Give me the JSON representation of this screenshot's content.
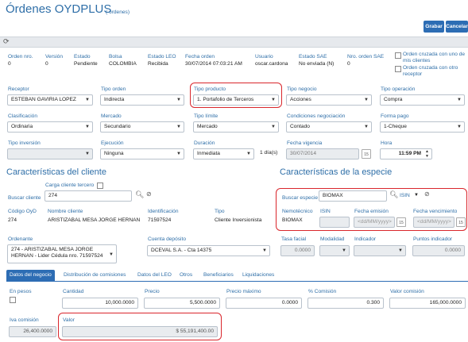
{
  "header": {
    "title": "Órdenes OYDPLUS",
    "subtitle": "( órdenes)",
    "grabar": "Grabar",
    "cancelar": "Cancelar"
  },
  "toolbar": {
    "refresh_icon": "refresh-icon"
  },
  "info": {
    "orden_nro": {
      "label": "Orden nro.",
      "value": "0"
    },
    "version": {
      "label": "Versión",
      "value": "0"
    },
    "estado": {
      "label": "Estado",
      "value": "Pendiente"
    },
    "bolsa": {
      "label": "Bolsa",
      "value": "COLOMBIA"
    },
    "estado_leo": {
      "label": "Estado LEO",
      "value": "Recibida"
    },
    "fecha_orden": {
      "label": "Fecha orden",
      "value": "30/07/2014 07:03:21 AM"
    },
    "usuario": {
      "label": "Usuario",
      "value": "oscar.cardona"
    },
    "estado_sae": {
      "label": "Estado SAE",
      "value": "No enviada (N)"
    },
    "nro_orden_sae": {
      "label": "Nro. orden SAE",
      "value": "0"
    },
    "cruzada_mis_clientes": "Orden cruzada con uno de mis clientes",
    "cruzada_otro_receptor": "Orden cruzada con otro receptor"
  },
  "row1": {
    "receptor": {
      "label": "Receptor",
      "value": "ESTEBAN GAVIRIA LOPEZ"
    },
    "tipo_orden": {
      "label": "Tipo orden",
      "value": "Indirecta"
    },
    "tipo_producto": {
      "label": "Tipo producto",
      "value": "1. Portafolio de Terceros"
    },
    "tipo_negocio": {
      "label": "Tipo negocio",
      "value": "Acciones"
    },
    "tipo_operacion": {
      "label": "Tipo operación",
      "value": "Compra"
    }
  },
  "row2": {
    "clasificacion": {
      "label": "Clasificación",
      "value": "Ordinaria"
    },
    "mercado": {
      "label": "Mercado",
      "value": "Secundario"
    },
    "tipo_limite": {
      "label": "Tipo límite",
      "value": "Mercado"
    },
    "condiciones": {
      "label": "Condiciones negociación",
      "value": "Contado"
    },
    "forma_pago": {
      "label": "Forma pago",
      "value": "1-Cheque"
    }
  },
  "row3": {
    "tipo_inversion": {
      "label": "Tipo inversión",
      "value": ""
    },
    "ejecucion": {
      "label": "Ejecución",
      "value": "Ninguna"
    },
    "duracion": {
      "label": "Duración",
      "value": "Inmediata",
      "dias": "1 día(s)"
    },
    "fecha_vigencia": {
      "label": "Fecha vigencia",
      "value": "30/07/2014",
      "cal": "15"
    },
    "hora": {
      "label": "Hora",
      "value": "11:59 PM"
    }
  },
  "cliente": {
    "title": "Características del cliente",
    "carga_tercero": "Carga cliente tercero",
    "buscar_label": "Buscar cliente",
    "buscar_value": "274",
    "codigo": {
      "label": "Código OyD",
      "value": "274"
    },
    "nombre": {
      "label": "Nombre cliente",
      "value": "ARISTIZABAL MESA JORGE HERNAN"
    },
    "identificacion": {
      "label": "Identificación",
      "value": "71597524"
    },
    "tipo": {
      "label": "Tipo",
      "value": "Cliente Inversionista"
    }
  },
  "especie": {
    "title": "Características de la especie",
    "buscar_label": "Buscar especie",
    "buscar_value": "BIOMAX",
    "isin_label": "ISIN",
    "nemotecnico": {
      "label": "Nemotécnico",
      "value": "BIOMAX"
    },
    "isin": {
      "label": "ISIN",
      "value": ""
    },
    "fecha_emision": {
      "label": "Fecha emisión",
      "placeholder": "<dd/MM/yyyy>",
      "cal": "15"
    },
    "fecha_vencimiento": {
      "label": "Fecha vencimiento",
      "placeholder": "<dd/MM/yyyy>",
      "cal": "15"
    }
  },
  "row4": {
    "ordenante": {
      "label": "Ordenante",
      "value": "274 - ARISTIZABAL MESA JORGE HERNAN  -  Lider Cédula nro. 71597524"
    },
    "cuenta": {
      "label": "Cuenta depósito",
      "value": "DCEVAL S.A. - Cta 14375"
    },
    "tasa_facial": {
      "label": "Tasa facial",
      "value": "0.0000"
    },
    "modalidad": {
      "label": "Modalidad",
      "value": ""
    },
    "indicador": {
      "label": "Indicador",
      "value": ""
    },
    "puntos": {
      "label": "Puntos indicador",
      "value": "0.0000"
    }
  },
  "tabs": [
    "Datos del negocio",
    "Distribución de comisiones",
    "Datos del LEO",
    "Otros",
    "Beneficiarios",
    "Liquidaciones"
  ],
  "negocio": {
    "en_pesos": "En pesos",
    "cantidad": {
      "label": "Cantidad",
      "value": "10,000.0000"
    },
    "precio": {
      "label": "Precio",
      "value": "5,500.0000"
    },
    "precio_maximo": {
      "label": "Precio máximo",
      "value": "0.0000"
    },
    "comision_pct": {
      "label": "% Comisión",
      "value": "0.300"
    },
    "valor_comision": {
      "label": "Valor comisión",
      "value": "165,000.0000"
    },
    "iva_comision": {
      "label": "Iva comisión",
      "value": "26,400.0000"
    },
    "valor": {
      "label": "Valor",
      "value": "$ 55,191,400.00"
    }
  },
  "colors": {
    "accent": "#2d6db4",
    "highlight": "#d9262c",
    "label": "#2f6fa8"
  }
}
